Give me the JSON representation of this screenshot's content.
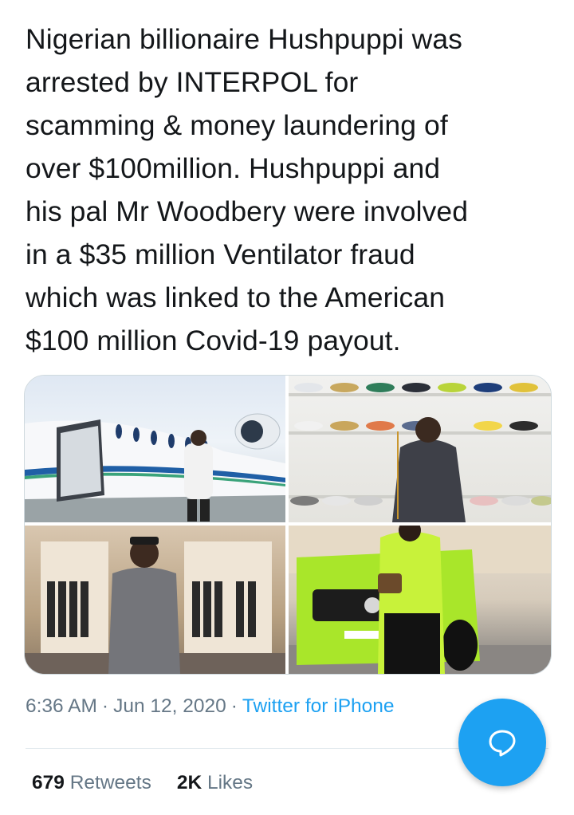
{
  "tweet": {
    "lines": [
      "Nigerian billionaire Hushpuppi was",
      "arrested by INTERPOL for",
      "scamming & money laundering of",
      "over $100million. Hushpuppi and",
      "his pal Mr Woodbery were involved",
      "in a $35 million Ventilator fraud",
      "which was linked to the American",
      "$100 million Covid-19 payout."
    ]
  },
  "media": {
    "photos": [
      {
        "icon": "photo-jet"
      },
      {
        "icon": "photo-sneaker-wall"
      },
      {
        "icon": "photo-boutique"
      },
      {
        "icon": "photo-green-suv"
      }
    ]
  },
  "meta": {
    "time": "6:36 AM",
    "separator": "·",
    "date": "Jun 12, 2020",
    "source": "Twitter for iPhone"
  },
  "stats": {
    "retweets_count": "679",
    "retweets_label": "Retweets",
    "likes_count": "2K",
    "likes_label": "Likes"
  },
  "colors": {
    "accent": "#1da1f2",
    "text": "#14171a",
    "secondary": "#657786"
  },
  "fab": {
    "icon": "reply-bubble-icon"
  }
}
